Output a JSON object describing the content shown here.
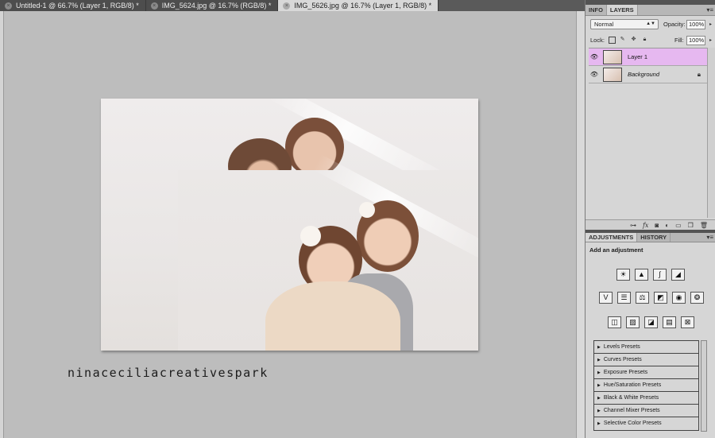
{
  "tabs": [
    {
      "label": "Untitled-1 @ 66.7% (Layer 1, RGB/8) *",
      "active": false
    },
    {
      "label": "IMG_5624.jpg @ 16.7% (RGB/8) *",
      "active": false
    },
    {
      "label": "IMG_5626.jpg @ 16.7% (Layer 1, RGB/8) *",
      "active": true
    }
  ],
  "watermark": "ninaceciliacreativespark",
  "layers_panel": {
    "tabs": [
      "INFO",
      "LAYERS"
    ],
    "active_tab": "LAYERS",
    "blend_mode": "Normal",
    "opacity_label": "Opacity:",
    "opacity_value": "100%",
    "lock_label": "Lock:",
    "fill_label": "Fill:",
    "fill_value": "100%",
    "layers": [
      {
        "name": "Layer 1",
        "selected": true,
        "visible": true,
        "locked": false
      },
      {
        "name": "Background",
        "selected": false,
        "visible": true,
        "locked": true
      }
    ]
  },
  "adjustments_panel": {
    "tabs": [
      "ADJUSTMENTS",
      "HISTORY"
    ],
    "active_tab": "ADJUSTMENTS",
    "title": "Add an adjustment",
    "presets": [
      "Levels Presets",
      "Curves Presets",
      "Exposure Presets",
      "Hue/Saturation Presets",
      "Black & White Presets",
      "Channel Mixer Presets",
      "Selective Color Presets"
    ]
  },
  "colors": {
    "selected_layer": "#e6b8f0",
    "canvas_bg": "#bdbdbd",
    "panel_bg": "#d6d6d6"
  }
}
